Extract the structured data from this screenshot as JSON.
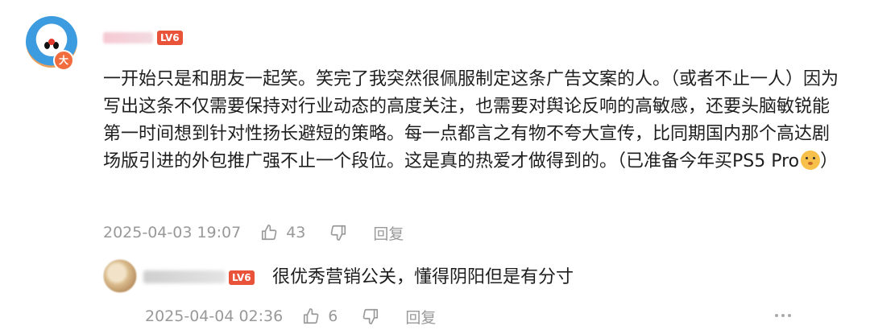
{
  "main_comment": {
    "avatar_icon": "doraemon-avatar-icon",
    "avatar_badge": "大",
    "level_badge": "LV6",
    "text": "一开始只是和朋友一起笑。笑完了我突然很佩服制定这条广告文案的人。（或者不止一人）因为写出这条不仅需要保持对行业动态的高度关注，也需要对舆论反响的高敏感，还要头脑敏锐能第一时间想到针对性扬长避短的策略。每一点都言之有物不夸大宣传，比同期国内那个高达剧场版引进的外包推广强不止一个段位。这是真的热爱才做得到的。（已准备今年买PS5 Pro",
    "text_suffix": "）",
    "emoji": "dog-face-emoji",
    "date": "2025-04-03 19:07",
    "likes": "43",
    "reply_label": "回复"
  },
  "reply_comment": {
    "level_badge": "LV6",
    "text": "很优秀营销公关，懂得阴阳但是有分寸",
    "date": "2025-04-04 02:36",
    "likes": "6",
    "reply_label": "回复"
  },
  "colors": {
    "level_badge": "#e8533a",
    "meta_text": "#999999",
    "body_text": "#1e1e1e"
  }
}
